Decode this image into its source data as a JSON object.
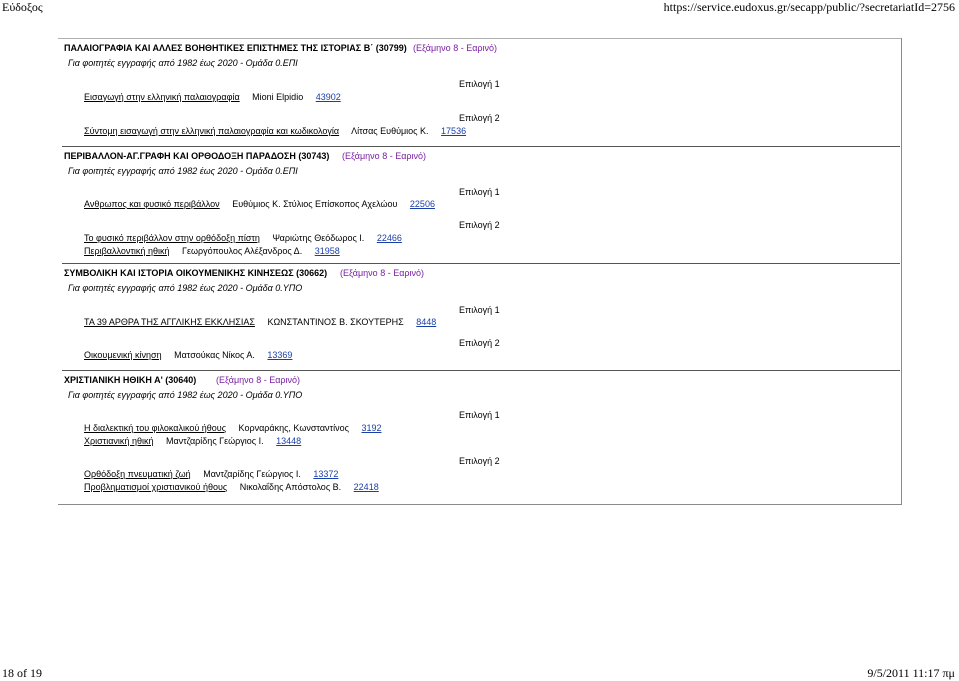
{
  "header": {
    "left": "Εύδοξος",
    "right": "https://service.eudoxus.gr/secapp/public/?secretariatId=2756"
  },
  "footer": {
    "page": "18 of 19",
    "datetime": "9/5/2011 11:17 πμ"
  },
  "courses": [
    {
      "title": "ΠΑΛΑΙΟΓΡΑΦΙΑ ΚΑΙ ΑΛΛΕΣ ΒΟΗΘΗΤΙΚΕΣ ΕΠΙΣΤΗΜΕΣ ΤΗΣ ΙΣΤΟΡΙΑΣ Β΄ (30799)",
      "semester": "(Εξάμηνο 8 - Εαρινό)",
      "subtitle": "Για φοιτητές εγγραφής από 1982 έως 2020 - Ομάδα 0.ΕΠΙ",
      "choices": [
        {
          "label": "Επιλογή 1",
          "books": [
            {
              "title": "Εισαγωγή στην ελληνική παλαιογραφία",
              "author": "Mioni Elpidio",
              "code": "43902"
            }
          ]
        },
        {
          "label": "Επιλογή 2",
          "books": [
            {
              "title": "Σύντομη εισαγωγή στην ελληνική παλαιογραφία και κωδικολογία",
              "author": "Λίτσας Ευθύμιος Κ.",
              "code": "17536"
            }
          ]
        }
      ]
    },
    {
      "title": "ΠΕΡΙΒΑΛΛΟΝ-ΑΓ.ΓΡΑΦΗ ΚΑΙ ΟΡΘΟΔΟΞΗ ΠΑΡΑΔΟΣΗ (30743)",
      "semester": "(Εξάμηνο 8 - Εαρινό)",
      "subtitle": "Για φοιτητές εγγραφής από 1982 έως 2020 - Ομάδα 0.ΕΠΙ",
      "choices": [
        {
          "label": "Επιλογή 1",
          "books": [
            {
              "title": "Ανθρωπος και φυσικό περιβάλλον",
              "author": "Ευθύμιος Κ. Στύλιος Επίσκοπος Αχελώου",
              "code": "22506"
            }
          ]
        },
        {
          "label": "Επιλογή 2",
          "books": [
            {
              "title": "Το φυσικό περιβάλλον στην ορθόδοξη πίστη",
              "author": "Ψαριώτης Θεόδωρος Ι.",
              "code": "22466"
            },
            {
              "title": "Περιβαλλοντική ηθική",
              "author": "Γεωργόπουλος Αλέξανδρος Δ.",
              "code": "31958"
            }
          ]
        }
      ]
    },
    {
      "title": "ΣΥΜΒΟΛΙΚΗ ΚΑΙ ΙΣΤΟΡΙΑ ΟΙΚΟΥΜΕΝΙΚΗΣ ΚΙΝΗΣΕΩΣ (30662)",
      "semester": "(Εξάμηνο 8 - Εαρινό)",
      "subtitle": "Για φοιτητές εγγραφής από 1982 έως 2020 - Ομάδα 0.ΥΠΟ",
      "choices": [
        {
          "label": "Επιλογή 1",
          "books": [
            {
              "title": "ΤΑ 39 ΑΡΘΡΑ ΤΗΣ ΑΓΓΛΙΚΗΣ ΕΚΚΛΗΣΙΑΣ",
              "author": "ΚΩΝΣΤΑΝΤΙΝΟΣ Β. ΣΚΟΥΤΕΡΗΣ",
              "code": "8448"
            }
          ]
        },
        {
          "label": "Επιλογή 2",
          "books": [
            {
              "title": "Οικουμενική κίνηση",
              "author": "Ματσούκας Νίκος Α.",
              "code": "13369"
            }
          ]
        }
      ]
    },
    {
      "title": "ΧΡΙΣΤΙΑΝΙΚΗ ΗΘΙΚΗ Α' (30640)",
      "semester": "(Εξάμηνο 8 - Εαρινό)",
      "subtitle": "Για φοιτητές εγγραφής από 1982 έως 2020 - Ομάδα 0.ΥΠΟ",
      "choices": [
        {
          "label": "Επιλογή 1",
          "books": [
            {
              "title": "Η διαλεκτική του φιλοκαλικού ήθους",
              "author": "Κορναράκης, Κωνσταντίνος",
              "code": "3192"
            },
            {
              "title": "Χριστιανική ηθική",
              "author": "Μαντζαρίδης Γεώργιος Ι.",
              "code": "13448"
            }
          ]
        },
        {
          "label": "Επιλογή 2",
          "books": [
            {
              "title": "Ορθόδοξη πνευματική ζωή",
              "author": "Μαντζαρίδης Γεώργιος Ι.",
              "code": "13372"
            },
            {
              "title": "Προβληματισμοί χριστιανικού ήθους",
              "author": "Νικολαΐδης Απόστολος Β.",
              "code": "22418"
            }
          ]
        }
      ]
    }
  ]
}
